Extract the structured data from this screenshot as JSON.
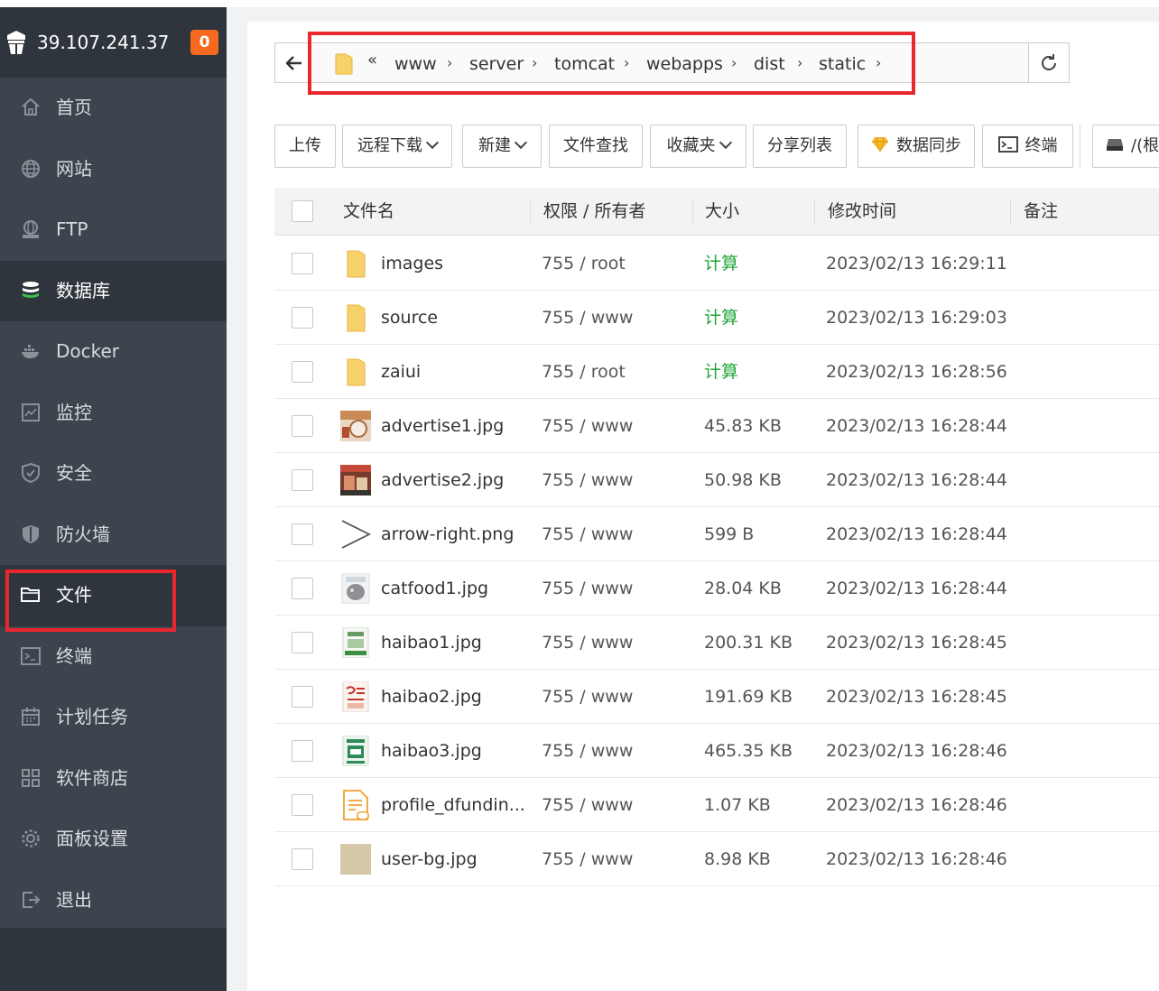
{
  "sidebar": {
    "server_ip": "39.107.241.37",
    "badge": "0",
    "items": [
      {
        "label": "首页",
        "icon": "home-icon"
      },
      {
        "label": "网站",
        "icon": "globe-icon"
      },
      {
        "label": "FTP",
        "icon": "ftp-icon"
      },
      {
        "label": "数据库",
        "icon": "database-icon",
        "active": true
      },
      {
        "label": "Docker",
        "icon": "docker-icon"
      },
      {
        "label": "监控",
        "icon": "monitor-icon"
      },
      {
        "label": "安全",
        "icon": "shield-check-icon"
      },
      {
        "label": "防火墙",
        "icon": "firewall-icon"
      },
      {
        "label": "文件",
        "icon": "folder-icon",
        "active": true
      },
      {
        "label": "终端",
        "icon": "terminal-icon"
      },
      {
        "label": "计划任务",
        "icon": "calendar-icon"
      },
      {
        "label": "软件商店",
        "icon": "apps-icon"
      },
      {
        "label": "面板设置",
        "icon": "gear-icon"
      },
      {
        "label": "退出",
        "icon": "logout-icon"
      }
    ]
  },
  "breadcrumb": {
    "more": "«",
    "parts": [
      "www",
      "server",
      "tomcat",
      "webapps",
      "dist",
      "static"
    ],
    "separator": "›"
  },
  "toolbar": {
    "upload": "上传",
    "remote_download": "远程下载",
    "new": "新建",
    "file_search": "文件查找",
    "favorites": "收藏夹",
    "share_list": "分享列表",
    "data_sync": "数据同步",
    "terminal": "终端",
    "root": "/(根"
  },
  "table": {
    "headers": {
      "name": "文件名",
      "perm": "权限 / 所有者",
      "size": "大小",
      "mtime": "修改时间",
      "note": "备注"
    },
    "rows": [
      {
        "name": "images",
        "type": "folder",
        "perm": "755 / root",
        "size": "计算",
        "mtime": "2023/02/13 16:29:11"
      },
      {
        "name": "source",
        "type": "folder",
        "perm": "755 / www",
        "size": "计算",
        "mtime": "2023/02/13 16:29:03"
      },
      {
        "name": "zaiui",
        "type": "folder",
        "perm": "755 / root",
        "size": "计算",
        "mtime": "2023/02/13 16:28:56"
      },
      {
        "name": "advertise1.jpg",
        "type": "image",
        "perm": "755 / www",
        "size": "45.83 KB",
        "mtime": "2023/02/13 16:28:44"
      },
      {
        "name": "advertise2.jpg",
        "type": "image",
        "perm": "755 / www",
        "size": "50.98 KB",
        "mtime": "2023/02/13 16:28:44"
      },
      {
        "name": "arrow-right.png",
        "type": "arrow",
        "perm": "755 / www",
        "size": "599 B",
        "mtime": "2023/02/13 16:28:44"
      },
      {
        "name": "catfood1.jpg",
        "type": "image",
        "perm": "755 / www",
        "size": "28.04 KB",
        "mtime": "2023/02/13 16:28:44"
      },
      {
        "name": "haibao1.jpg",
        "type": "image",
        "perm": "755 / www",
        "size": "200.31 KB",
        "mtime": "2023/02/13 16:28:45"
      },
      {
        "name": "haibao2.jpg",
        "type": "image",
        "perm": "755 / www",
        "size": "191.69 KB",
        "mtime": "2023/02/13 16:28:45"
      },
      {
        "name": "haibao3.jpg",
        "type": "image",
        "perm": "755 / www",
        "size": "465.35 KB",
        "mtime": "2023/02/13 16:28:46"
      },
      {
        "name": "profile_dfundin...",
        "type": "config",
        "perm": "755 / www",
        "size": "1.07 KB",
        "mtime": "2023/02/13 16:28:46"
      },
      {
        "name": "user-bg.jpg",
        "type": "image",
        "perm": "755 / www",
        "size": "8.98 KB",
        "mtime": "2023/02/13 16:28:46"
      }
    ]
  },
  "colors": {
    "sidebar_bg": "#3c444d",
    "sidebar_active": "#2f353c",
    "badge": "#f66a1f",
    "calc_green": "#20a53a",
    "highlight_red": "#e8272e"
  }
}
